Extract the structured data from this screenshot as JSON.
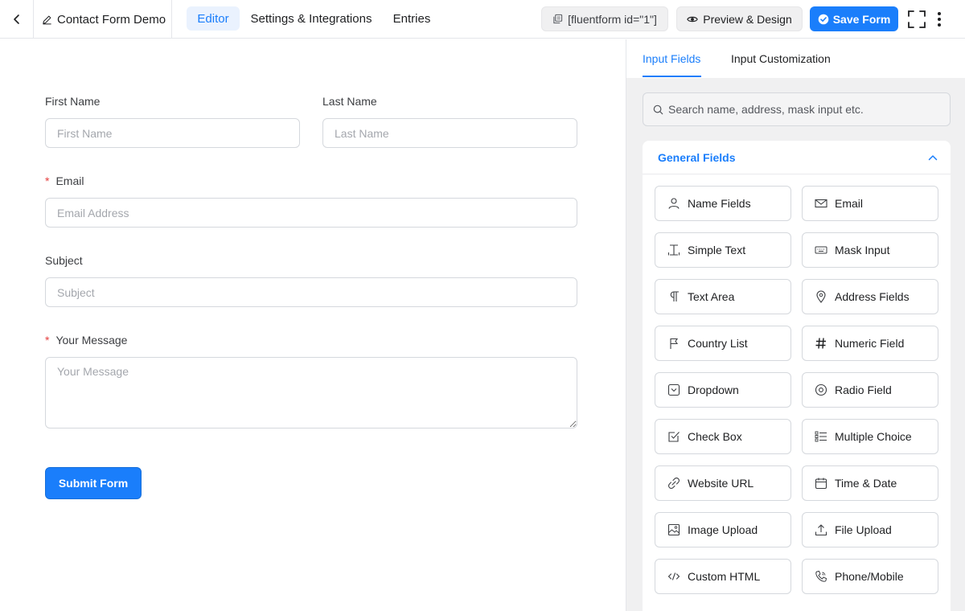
{
  "header": {
    "form_title": "Contact Form Demo",
    "tabs": [
      {
        "label": "Editor",
        "active": true
      },
      {
        "label": "Settings & Integrations",
        "active": false
      },
      {
        "label": "Entries",
        "active": false
      }
    ],
    "shortcode": "[fluentform id=\"1\"]",
    "preview_label": "Preview & Design",
    "save_label": "Save Form"
  },
  "form": {
    "first_name": {
      "label": "First Name",
      "placeholder": "First Name"
    },
    "last_name": {
      "label": "Last Name",
      "placeholder": "Last Name"
    },
    "email": {
      "label": "Email",
      "placeholder": "Email Address",
      "required": true
    },
    "subject": {
      "label": "Subject",
      "placeholder": "Subject"
    },
    "message": {
      "label": "Your Message",
      "placeholder": "Your Message",
      "required": true
    },
    "submit_label": "Submit Form"
  },
  "sidebar": {
    "tabs": [
      {
        "label": "Input Fields",
        "active": true
      },
      {
        "label": "Input Customization",
        "active": false
      }
    ],
    "search_placeholder": "Search name, address, mask input etc.",
    "section_title": "General Fields",
    "fields": [
      {
        "label": "Name Fields",
        "icon": "person-icon"
      },
      {
        "label": "Email",
        "icon": "envelope-icon"
      },
      {
        "label": "Simple Text",
        "icon": "text-cursor-icon"
      },
      {
        "label": "Mask Input",
        "icon": "keyboard-icon"
      },
      {
        "label": "Text Area",
        "icon": "paragraph-icon"
      },
      {
        "label": "Address Fields",
        "icon": "map-pin-icon"
      },
      {
        "label": "Country List",
        "icon": "flag-icon"
      },
      {
        "label": "Numeric Field",
        "icon": "hash-icon"
      },
      {
        "label": "Dropdown",
        "icon": "dropdown-icon"
      },
      {
        "label": "Radio Field",
        "icon": "radio-icon"
      },
      {
        "label": "Check Box",
        "icon": "checkbox-icon"
      },
      {
        "label": "Multiple Choice",
        "icon": "list-icon"
      },
      {
        "label": "Website URL",
        "icon": "link-icon"
      },
      {
        "label": "Time & Date",
        "icon": "calendar-icon"
      },
      {
        "label": "Image Upload",
        "icon": "image-icon"
      },
      {
        "label": "File Upload",
        "icon": "upload-icon"
      },
      {
        "label": "Custom HTML",
        "icon": "code-icon"
      },
      {
        "label": "Phone/Mobile",
        "icon": "phone-icon"
      }
    ]
  },
  "colors": {
    "accent": "#1a7efb",
    "required": "#e53e3e"
  }
}
